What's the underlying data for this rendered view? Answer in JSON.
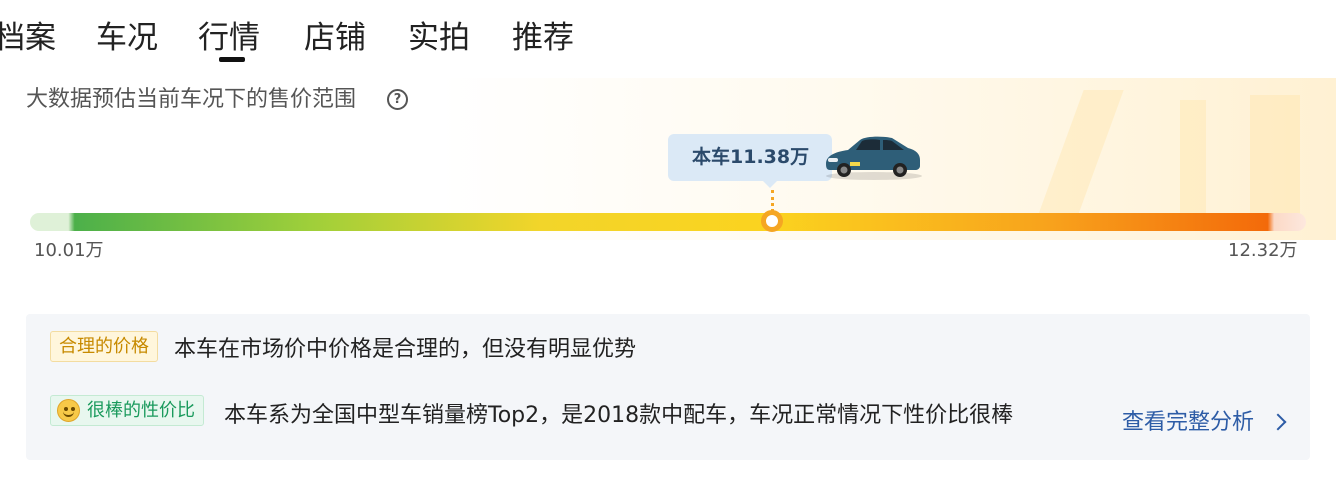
{
  "tabs": [
    {
      "label": "档案"
    },
    {
      "label": "车况"
    },
    {
      "label": "行情",
      "active": true
    },
    {
      "label": "店铺"
    },
    {
      "label": "实拍"
    },
    {
      "label": "推荐"
    }
  ],
  "market": {
    "subtitle": "大数据预估当前车况下的售价范围",
    "help_icon": "question-circle-icon",
    "current_price_label": "本车11.38万",
    "min_price": "10.01万",
    "max_price": "12.32万",
    "price_position_fraction": 0.6,
    "colors": {
      "marker": "#f5a623",
      "bar_start": "#4cb04a",
      "bar_mid": "#fbd31f",
      "bar_end": "#f36a0a"
    }
  },
  "analysis": {
    "price_badge": "合理的价格",
    "price_text": "本车在市场价中价格是合理的，但没有明显优势",
    "value_badge": "很棒的性价比",
    "value_icon": "smile-icon",
    "value_text": "本车系为全国中型车销量榜Top2，是2018款中配车，车况正常情况下性价比很棒",
    "full_analysis_link": "查看完整分析",
    "link_icon": "chevron-right-icon"
  }
}
